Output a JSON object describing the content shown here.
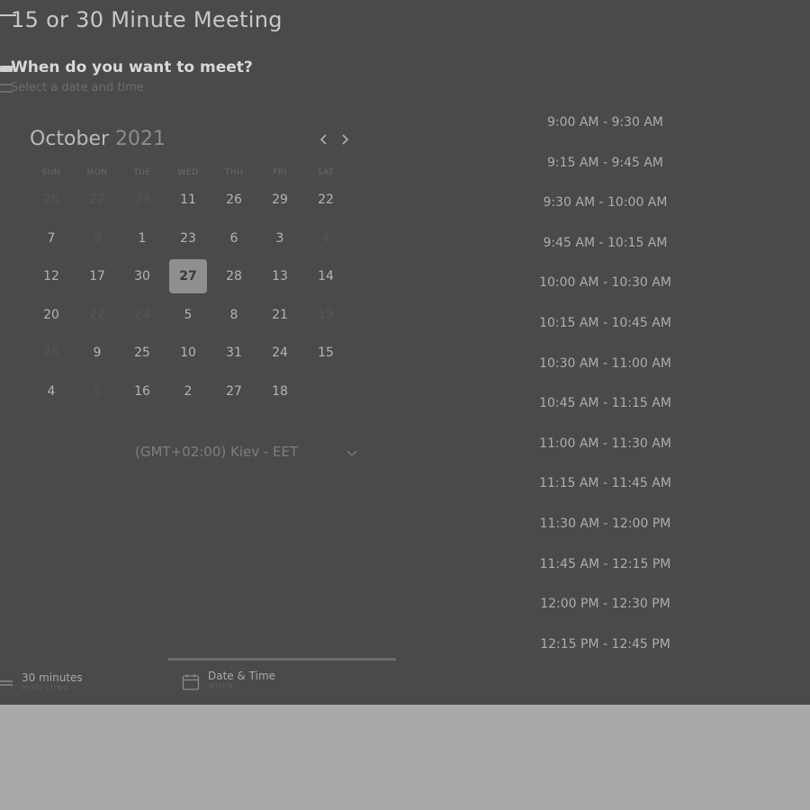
{
  "header": {
    "title": "15 or 30 Minute Meeting",
    "subtitle": "When do you want to meet?",
    "hint": "Select a date and time"
  },
  "calendar": {
    "month": "October",
    "year": "2021",
    "weekdays": [
      "SUN",
      "MON",
      "TUE",
      "WED",
      "THU",
      "FRI",
      "SAT"
    ],
    "rows": [
      [
        {
          "d": "26",
          "dim": true
        },
        {
          "d": "27",
          "dim": true
        },
        {
          "d": "28",
          "dim": true
        },
        {
          "d": "11"
        },
        {
          "d": "26"
        },
        {
          "d": "29"
        },
        {
          "d": "22"
        }
      ],
      [
        {
          "d": "7"
        },
        {
          "d": "8",
          "dim": true
        },
        {
          "d": "1"
        },
        {
          "d": "23"
        },
        {
          "d": "6"
        },
        {
          "d": "3"
        },
        {
          "d": "4",
          "dim": true
        }
      ],
      [
        {
          "d": "12"
        },
        {
          "d": "17"
        },
        {
          "d": "30"
        },
        {
          "d": "27",
          "selected": true
        },
        {
          "d": "28"
        },
        {
          "d": "13"
        },
        {
          "d": "14"
        }
      ],
      [
        {
          "d": "20"
        },
        {
          "d": "22",
          "dim": true
        },
        {
          "d": "24",
          "dim": true
        },
        {
          "d": "5"
        },
        {
          "d": "8"
        },
        {
          "d": "21"
        },
        {
          "d": "19",
          "dim": true
        }
      ],
      [
        {
          "d": "26",
          "dim": true
        },
        {
          "d": "9"
        },
        {
          "d": "25"
        },
        {
          "d": "10"
        },
        {
          "d": "31"
        },
        {
          "d": "24"
        },
        {
          "d": "15"
        }
      ],
      [
        {
          "d": "4"
        },
        {
          "d": "5",
          "dim": true
        },
        {
          "d": "16"
        },
        {
          "d": "2"
        },
        {
          "d": "27"
        },
        {
          "d": "18"
        },
        {
          "d": ""
        }
      ]
    ]
  },
  "timezone": {
    "value": "(GMT+02:00) Kiev - EET"
  },
  "slots": [
    "9:00 AM - 9:30 AM",
    "9:15 AM - 9:45 AM",
    "9:30 AM - 10:00 AM",
    "9:45 AM - 10:15 AM",
    "10:00 AM - 10:30 AM",
    "10:15 AM - 10:45 AM",
    "10:30 AM - 11:00 AM",
    "10:45 AM - 11:15 AM",
    "11:00 AM - 11:30 AM",
    "11:15 AM - 11:45 AM",
    "11:30 AM - 12:00 PM",
    "11:45 AM - 12:15 PM",
    "12:00 PM - 12:30 PM",
    "12:15 PM - 12:45 PM"
  ],
  "steps": [
    {
      "title": "30 minutes",
      "sub": "HOW LONG"
    },
    {
      "title": "Date & Time",
      "sub": "WHEN"
    },
    {
      "title": "",
      "sub": ""
    },
    {
      "title": "",
      "sub": ""
    }
  ],
  "icons": {
    "nav_prev": "chevron-left-icon",
    "nav_next": "chevron-right-icon",
    "dropdown": "chevron-down-icon",
    "step_when": "calendar-icon"
  },
  "colors": {
    "background": "#4a4a4a",
    "selected_day": "#8f8f8f",
    "text": "#b4b4b4"
  }
}
